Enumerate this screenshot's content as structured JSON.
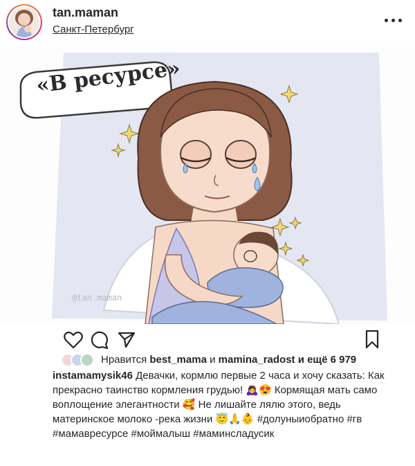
{
  "header": {
    "username": "tan.maman",
    "location": "Санкт-Петербург",
    "more_icon": "more-horizontal-icon"
  },
  "photo": {
    "title_text": "«В ресурсе»",
    "watermark": "@tan.maman",
    "background_color": "#e4e6f2",
    "hair_color": "#8a5a44",
    "blanket_color": "#9fb3de"
  },
  "actions": {
    "icons": [
      "heart-icon",
      "comment-icon",
      "share-icon",
      "bookmark-icon"
    ]
  },
  "likes": {
    "prefix": "Нравится",
    "user1": "best_mama",
    "conj": "и",
    "user2": "mamina_radost",
    "suffix": "и ещё 6 979"
  },
  "caption": {
    "author": "instamamysik46",
    "text": "Девачки, кормлю первые 2 часа и хочу сказать: Как прекрасно таинство кормления грудью! 🙇‍♀️😍 Кормящая мать само воплощение элегантности 🥰 Не лишайте лялю этого, ведь материнское молоко -река жизни 😇🙏👶",
    "hashtags": "#долуныиобратно #гв #мамавресурсе #моймалыш #маминсладусик"
  }
}
